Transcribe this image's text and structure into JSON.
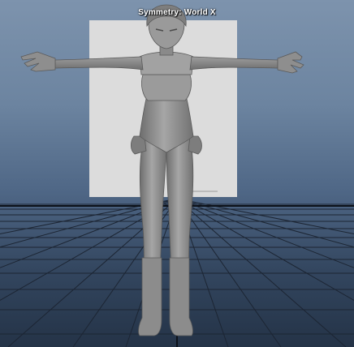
{
  "viewport": {
    "hud_symmetry_label": "Symmetry: World X",
    "background_gradient": [
      "#7d93ad",
      "#6c84a0",
      "#4f6786",
      "#243347"
    ],
    "grid_color": "#1c2533",
    "image_plane_color": "#dcdcdc",
    "model_color": "#8f8f8f"
  }
}
